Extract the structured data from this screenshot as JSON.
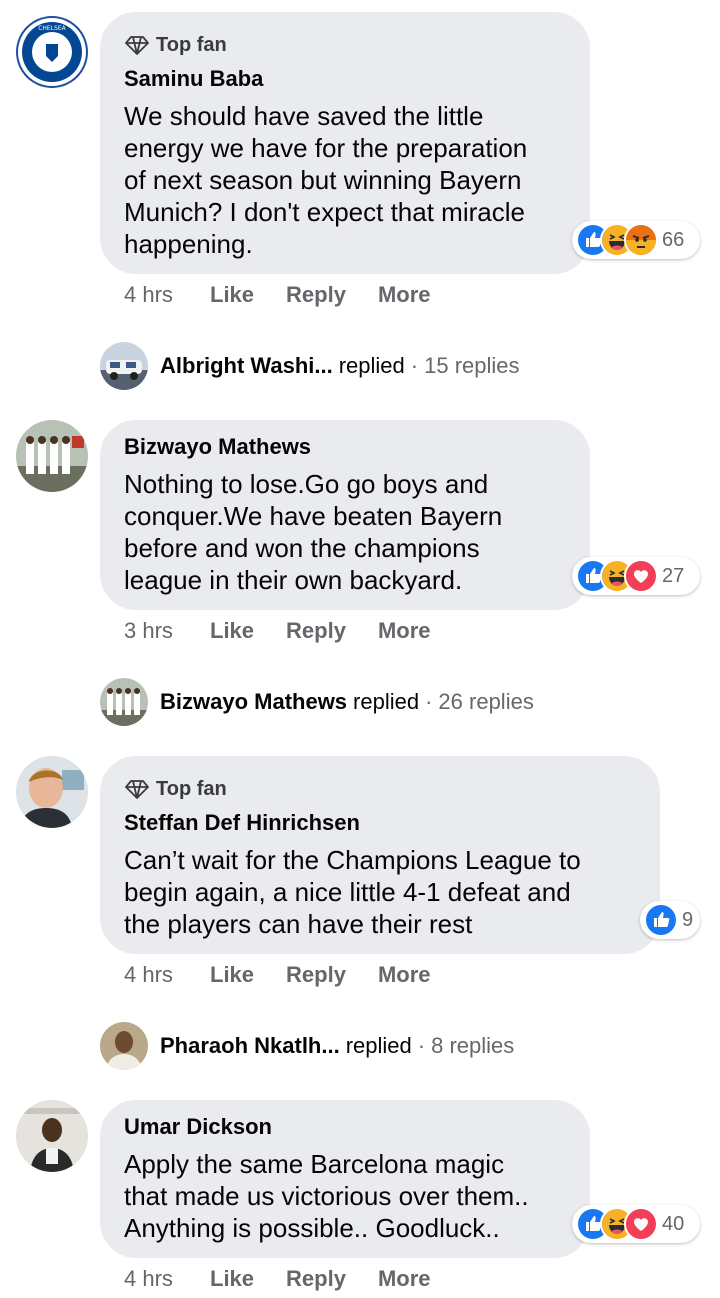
{
  "comments": [
    {
      "badge": "Top fan",
      "author": "Saminu Baba",
      "text": "We should have saved the little\nenergy we have for the preparation\nof next season but winning Bayern\nMunich? I don't expect that miracle\nhappening.",
      "reaction_count": "66",
      "reactions": [
        "like-icon",
        "haha-icon",
        "angry-icon"
      ],
      "time": "4 hrs",
      "like": "Like",
      "reply": "Reply",
      "more": "More",
      "replies": {
        "name": "Albright Washi...",
        "verb": "replied",
        "sep": "·",
        "count": "15 replies"
      }
    },
    {
      "author": "Bizwayo Mathews",
      "text": "Nothing to lose.Go go boys and\nconquer.We have beaten Bayern\nbefore and won the champions\nleague in their own backyard.",
      "reaction_count": "27",
      "reactions": [
        "like-icon",
        "haha-icon",
        "love-icon"
      ],
      "time": "3 hrs",
      "like": "Like",
      "reply": "Reply",
      "more": "More",
      "replies": {
        "name": "Bizwayo Mathews",
        "verb": "replied",
        "sep": "·",
        "count": "26 replies"
      }
    },
    {
      "badge": "Top fan",
      "author": "Steffan Def Hinrichsen",
      "text": "Can’t wait for the Champions League to\nbegin again, a nice little 4-1 defeat and\nthe players can have their rest",
      "reaction_count": "9",
      "reactions": [
        "like-icon"
      ],
      "time": "4 hrs",
      "like": "Like",
      "reply": "Reply",
      "more": "More",
      "replies": {
        "name": "Pharaoh Nkatlh...",
        "verb": "replied",
        "sep": "·",
        "count": "8 replies"
      }
    },
    {
      "author": "Umar Dickson",
      "text": "Apply the same Barcelona magic\nthat made us victorious over them..\nAnything is possible.. Goodluck..",
      "reaction_count": "40",
      "reactions": [
        "like-icon",
        "haha-icon",
        "love-icon"
      ],
      "time": "4 hrs",
      "like": "Like",
      "reply": "Reply",
      "more": "More"
    }
  ],
  "colors": {
    "like": "#1877f2",
    "haha": "#f7b125",
    "angry": "#e9710f",
    "love": "#f33e58",
    "bubble": "#e9ebee",
    "meta": "#65676b"
  }
}
